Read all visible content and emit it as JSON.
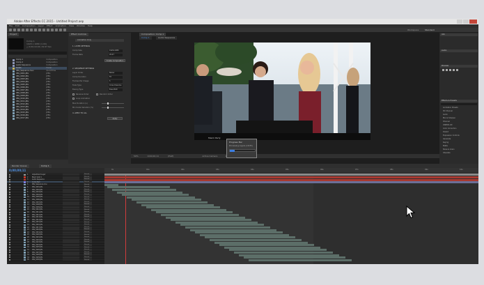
{
  "window": {
    "title": "Adobe After Effects CC 2015 - Untitled Project.aep",
    "controls": [
      "minimize",
      "maximize",
      "close"
    ]
  },
  "menu": [
    "File",
    "Edit",
    "Composition",
    "Layer",
    "Effect",
    "Animation",
    "View",
    "Window",
    "Help"
  ],
  "workspace": {
    "label": "Workspace",
    "value": "Standard"
  },
  "project": {
    "tab": "Project",
    "thumb_meta": [
      "Comp 1",
      "1920 x 1080 (1.00)",
      "△ 0;00;10;00, 29.97 fps"
    ],
    "items": [
      {
        "name": "Comp 1",
        "type": "Composition",
        "color": "#8a94b4"
      },
      {
        "name": "Comp 2",
        "type": "Composition",
        "color": "#8a94b4"
      },
      {
        "name": "Audio Sequence",
        "type": "Composition",
        "color": "#8a94b4"
      },
      {
        "name": "Solids",
        "type": "Folder",
        "color": "#c4b35e"
      },
      {
        "name": "IMG_Sequence.mov",
        "type": "QuickTime",
        "color": "#7f9fb3"
      },
      {
        "name": "IMG_0001.JPG",
        "type": "JPEG",
        "color": "#7f9fb3"
      },
      {
        "name": "IMG_0002.JPG",
        "type": "JPEG",
        "color": "#7f9fb3"
      },
      {
        "name": "IMG_0003.JPG",
        "type": "JPEG",
        "color": "#7f9fb3"
      },
      {
        "name": "IMG_0004.JPG",
        "type": "JPEG",
        "color": "#7f9fb3"
      },
      {
        "name": "IMG_0005.JPG",
        "type": "JPEG",
        "color": "#7f9fb3"
      },
      {
        "name": "IMG_0006.JPG",
        "type": "JPEG",
        "color": "#7f9fb3"
      },
      {
        "name": "IMG_0007.JPG",
        "type": "JPEG",
        "color": "#7f9fb3"
      },
      {
        "name": "IMG_0008.JPG",
        "type": "JPEG",
        "color": "#7f9fb3"
      },
      {
        "name": "IMG_0009.JPG",
        "type": "JPEG",
        "color": "#7f9fb3"
      },
      {
        "name": "IMG_0010.JPG",
        "type": "JPEG",
        "color": "#7f9fb3"
      },
      {
        "name": "IMG_0011.JPG",
        "type": "JPEG",
        "color": "#7f9fb3"
      },
      {
        "name": "IMG_0012.JPG",
        "type": "JPEG",
        "color": "#7f9fb3"
      },
      {
        "name": "IMG_0013.JPG",
        "type": "JPEG",
        "color": "#7f9fb3"
      },
      {
        "name": "IMG_0014.JPG",
        "type": "JPEG",
        "color": "#7f9fb3"
      },
      {
        "name": "IMG_0015.JPG",
        "type": "JPEG",
        "color": "#7f9fb3"
      },
      {
        "name": "IMG_0016.JPG",
        "type": "JPEG",
        "color": "#7f9fb3"
      },
      {
        "name": "IMG_0017.JPG",
        "type": "JPEG",
        "color": "#7f9fb3"
      }
    ]
  },
  "effect_controls": {
    "tab": "Effect Controls",
    "sub": "Animation Only",
    "sections": [
      "1. LAYER SETTINGS",
      "2. SEQUENCE SETTINGS",
      "3. ANIMATION OPTIONS",
      "4. APPLY TO ALL"
    ],
    "rows": [
      {
        "label": "Comp Size",
        "value": "1920x1080"
      },
      {
        "label": "Frame Rate",
        "value": "29.97"
      },
      {
        "label": "Layer Order",
        "value": "Below"
      },
      {
        "label": "Comp Duration",
        "value": "Fit"
      },
      {
        "label": "Frames Per Image",
        "value": "5"
      },
      {
        "label": "Fade Type",
        "value": "Cross Dissolve"
      },
      {
        "label": "Easing Type",
        "value": "Ease Both"
      }
    ],
    "buttons": [
      "Create Composition",
      "Apply"
    ],
    "checks": [
      "Reverse Order",
      "Random Order",
      "Loop Animation"
    ],
    "sliders": [
      "Max Duration (s)",
      "Min Scale Variation (%)"
    ]
  },
  "composition": {
    "tab": "Composition: Comp 1",
    "subtabs": [
      "Comp 1",
      "Audio Sequence"
    ],
    "zoom": "50%",
    "timecode": "0;00;00;11",
    "resolution": "(Half)",
    "camera": "Active Camera",
    "views": "1 View",
    "caption": "Miami Party"
  },
  "right_panels": {
    "info": "Info",
    "audio": "Audio",
    "preview": "Preview",
    "effects": "Effects & Presets",
    "effect_list": [
      "Animation Presets",
      "3D Channel",
      "Audio",
      "Blur & Sharpen",
      "Channel",
      "CINEMA 4D",
      "Color Correction",
      "Distort",
      "Expression Controls",
      "Generate",
      "Keying",
      "Matte",
      "Noise & Grain",
      "Obsolete"
    ]
  },
  "timeline": {
    "tabs": [
      "Render Queue",
      "Comp 1"
    ],
    "timecode": "0;00;00;11",
    "mode_label": "Normal",
    "layers": [
      {
        "num": "1",
        "name": "Adjustment Layer",
        "color": "#a0a0a0"
      },
      {
        "num": "2",
        "name": "Black Solid 1",
        "color": "#c2392b"
      },
      {
        "num": "3",
        "name": "Audio Sequence",
        "color": "#c2392b"
      },
      {
        "num": "4",
        "name": "Comp Null",
        "color": "#7f7fe0"
      },
      {
        "num": "5",
        "name": "IMG_Sequence.mov",
        "color": "#7f9fb3"
      },
      {
        "num": "6",
        "name": "IMG_0001.JPG",
        "color": "#7f9fb3"
      },
      {
        "num": "7",
        "name": "IMG_0002.JPG",
        "color": "#7f9fb3"
      },
      {
        "num": "8",
        "name": "IMG_0003.JPG",
        "color": "#7f9fb3"
      },
      {
        "num": "9",
        "name": "IMG_0004.JPG",
        "color": "#7f9fb3"
      },
      {
        "num": "10",
        "name": "IMG_0005.JPG",
        "color": "#7f9fb3"
      },
      {
        "num": "11",
        "name": "IMG_0006.JPG",
        "color": "#7f9fb3"
      },
      {
        "num": "12",
        "name": "IMG_0007.JPG",
        "color": "#7f9fb3"
      },
      {
        "num": "13",
        "name": "IMG_0008.JPG",
        "color": "#7f9fb3"
      },
      {
        "num": "14",
        "name": "IMG_0009.JPG",
        "color": "#7f9fb3"
      },
      {
        "num": "15",
        "name": "IMG_0010.JPG",
        "color": "#7f9fb3"
      },
      {
        "num": "16",
        "name": "IMG_0011.JPG",
        "color": "#7f9fb3"
      },
      {
        "num": "17",
        "name": "IMG_0012.JPG",
        "color": "#7f9fb3"
      },
      {
        "num": "18",
        "name": "IMG_0013.JPG",
        "color": "#7f9fb3"
      },
      {
        "num": "19",
        "name": "IMG_0014.JPG",
        "color": "#7f9fb3"
      },
      {
        "num": "20",
        "name": "IMG_0015.JPG",
        "color": "#7f9fb3"
      },
      {
        "num": "21",
        "name": "IMG_0016.JPG",
        "color": "#7f9fb3"
      },
      {
        "num": "22",
        "name": "IMG_0017.JPG",
        "color": "#7f9fb3"
      },
      {
        "num": "23",
        "name": "IMG_0018.JPG",
        "color": "#7f9fb3"
      },
      {
        "num": "24",
        "name": "IMG_0019.JPG",
        "color": "#7f9fb3"
      },
      {
        "num": "25",
        "name": "IMG_0020.JPG",
        "color": "#7f9fb3"
      },
      {
        "num": "26",
        "name": "IMG_0021.JPG",
        "color": "#7f9fb3"
      },
      {
        "num": "27",
        "name": "IMG_0022.JPG",
        "color": "#7f9fb3"
      },
      {
        "num": "28",
        "name": "IMG_0023.JPG",
        "color": "#7f9fb3"
      },
      {
        "num": "29",
        "name": "IMG_0024.JPG",
        "color": "#7f9fb3"
      },
      {
        "num": "30",
        "name": "IMG_0025.JPG",
        "color": "#7f9fb3"
      },
      {
        "num": "31",
        "name": "IMG_0026.JPG",
        "color": "#7f9fb3"
      },
      {
        "num": "32",
        "name": "IMG_0027.JPG",
        "color": "#7f9fb3"
      },
      {
        "num": "33",
        "name": "IMG_0028.JPG",
        "color": "#7f9fb3"
      },
      {
        "num": "34",
        "name": "IMG_0029.JPG",
        "color": "#7f9fb3"
      },
      {
        "num": "35",
        "name": "IMG_0030.JPG",
        "color": "#7f9fb3"
      }
    ],
    "ruler_ticks": [
      "0s",
      "01s",
      "02s",
      "03s",
      "04s",
      "05s",
      "06s",
      "07s",
      "08s",
      "09s",
      "10s"
    ]
  },
  "progress_popup": {
    "title": "Progress Bar",
    "body": "Processing Layers (13/35)",
    "fraction": 0.2
  },
  "colors": {
    "accent": "#3c7de0",
    "playhead": "#d23c3c",
    "image_bar": "#5c6e68",
    "red_bar": "#a83a32"
  }
}
